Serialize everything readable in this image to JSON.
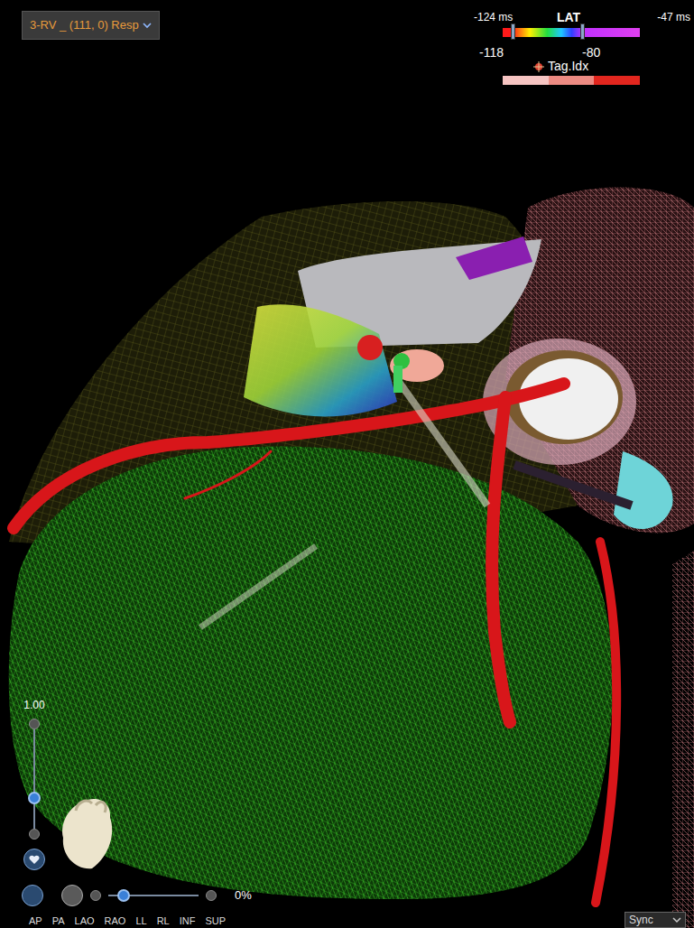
{
  "map_selector": {
    "label": "3-RV _ (111, 0) Resp"
  },
  "lat_legend": {
    "title": "LAT",
    "min": "-124 ms",
    "max": "-47 ms",
    "low_marker": "-118",
    "high_marker": "-80",
    "low_level": 0.07,
    "high_level": 0.58
  },
  "tag_index": {
    "label": "Tag.Idx",
    "segments": [
      {
        "color": "#f6c4c2"
      },
      {
        "color": "#ec8a82"
      },
      {
        "color": "#e2261e"
      }
    ]
  },
  "zoom": {
    "value": "1.00",
    "level": 0.31
  },
  "transparency": {
    "reading": "0%",
    "level": 0
  },
  "views": [
    "AP",
    "PA",
    "LAO",
    "RAO",
    "LL",
    "RL",
    "INF",
    "SUP"
  ],
  "sync": {
    "label": "Sync"
  }
}
